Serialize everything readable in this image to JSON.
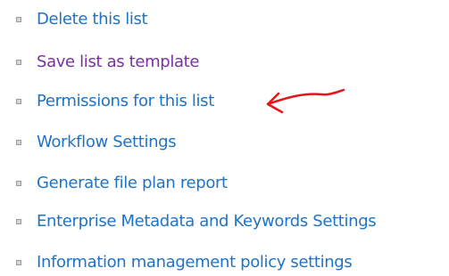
{
  "settings": {
    "links": [
      {
        "label": "Delete this list",
        "color": "#1e73c6"
      },
      {
        "label": "Save list as template",
        "color": "#7b2fa4"
      },
      {
        "label": "Permissions for this list",
        "color": "#1e73c6"
      },
      {
        "label": "Workflow Settings",
        "color": "#1e73c6"
      },
      {
        "label": "Generate file plan report",
        "color": "#1e73c6"
      },
      {
        "label": "Enterprise Metadata and Keywords Settings",
        "color": "#1e73c6"
      },
      {
        "label": "Information management policy settings",
        "color": "#1e73c6"
      }
    ]
  },
  "annotation": {
    "arrow_color": "#e8141b",
    "icon": "hand-drawn-arrow-icon"
  }
}
